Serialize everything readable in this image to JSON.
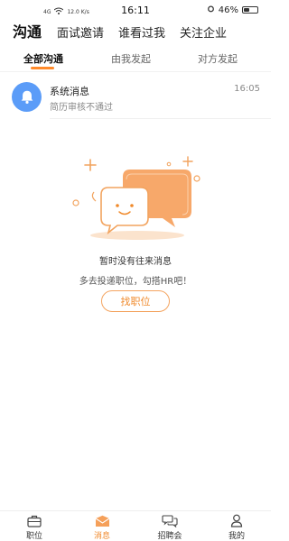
{
  "status_bar": {
    "network": "4G",
    "speed": "12.0 K/s",
    "time": "16:11",
    "battery_percent": "46%",
    "battery_level": 0.46
  },
  "header": {
    "title": "沟通",
    "tabs": [
      {
        "label": "面试邀请"
      },
      {
        "label": "谁看过我"
      },
      {
        "label": "关注企业"
      }
    ]
  },
  "subtabs": [
    {
      "label": "全部沟通",
      "active": true
    },
    {
      "label": "由我发起",
      "active": false
    },
    {
      "label": "对方发起",
      "active": false
    }
  ],
  "message": {
    "icon": "bell-icon",
    "title": "系统消息",
    "time": "16:05",
    "subtitle": "简历审核不通过"
  },
  "empty_state": {
    "title": "暂时没有往来消息",
    "subtitle": "多去投递职位，勾搭HR吧！",
    "button_label": "找职位"
  },
  "bottom_nav": [
    {
      "label": "职位",
      "icon": "briefcase-icon",
      "active": false
    },
    {
      "label": "消息",
      "icon": "envelope-icon",
      "active": true
    },
    {
      "label": "招聘会",
      "icon": "chat-bubbles-icon",
      "active": false
    },
    {
      "label": "我的",
      "icon": "person-icon",
      "active": false
    }
  ],
  "colors": {
    "accent": "#f08a2c",
    "bell_bg": "#5b9cf8"
  }
}
